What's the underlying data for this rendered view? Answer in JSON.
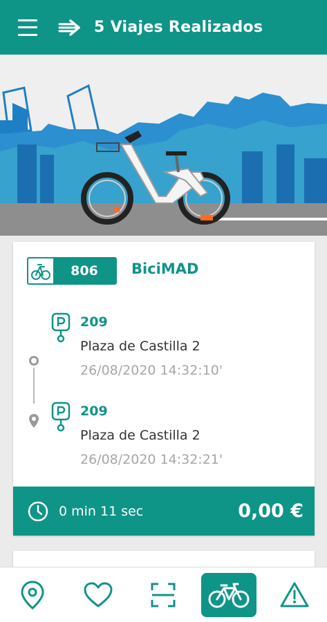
{
  "header": {
    "title": "5 Viajes Realizados",
    "menu_icon": "hamburger-menu-icon",
    "trips_icon": "arrow-trips-icon"
  },
  "trip": {
    "bike_number": "806",
    "service": "BiciMAD",
    "origin": {
      "station": "209",
      "place": "Plaza de Castilla 2",
      "datetime": "26/08/2020 14:32:10'"
    },
    "destination": {
      "station": "209",
      "place": "Plaza de Castilla 2",
      "datetime": "26/08/2020 14:32:21'"
    },
    "duration": "0 min 11 sec",
    "price": "0,00 €"
  },
  "nav": {
    "items": [
      {
        "icon": "location-pin-icon",
        "active": false
      },
      {
        "icon": "heart-icon",
        "active": false
      },
      {
        "icon": "qr-scan-icon",
        "active": false
      },
      {
        "icon": "bicycle-icon",
        "active": true
      },
      {
        "icon": "warning-icon",
        "active": false
      }
    ]
  },
  "colors": {
    "brand": "#0f9488",
    "text_dark": "#333333",
    "text_muted": "#a6a6a6"
  }
}
